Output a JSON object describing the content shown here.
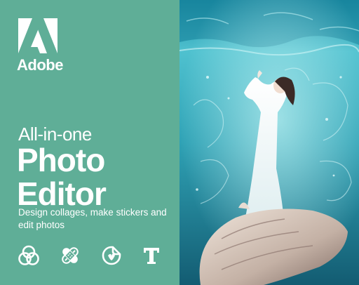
{
  "brand": {
    "name": "Adobe",
    "logo_icon": "adobe-a-logo",
    "color": "#ffffff"
  },
  "headline": {
    "tagline": "All-in-one",
    "title_line_1": "Photo",
    "title_line_2": "Editor"
  },
  "description": "Design collages, make stickers and edit photos",
  "features": [
    {
      "icon": "color-circles-icon"
    },
    {
      "icon": "bandage-icon"
    },
    {
      "icon": "sticker-icon"
    },
    {
      "icon": "text-icon"
    }
  ],
  "theme": {
    "panel_background": "#5fae97",
    "text_color": "#ffffff",
    "water_color": "#3aa7b8"
  }
}
